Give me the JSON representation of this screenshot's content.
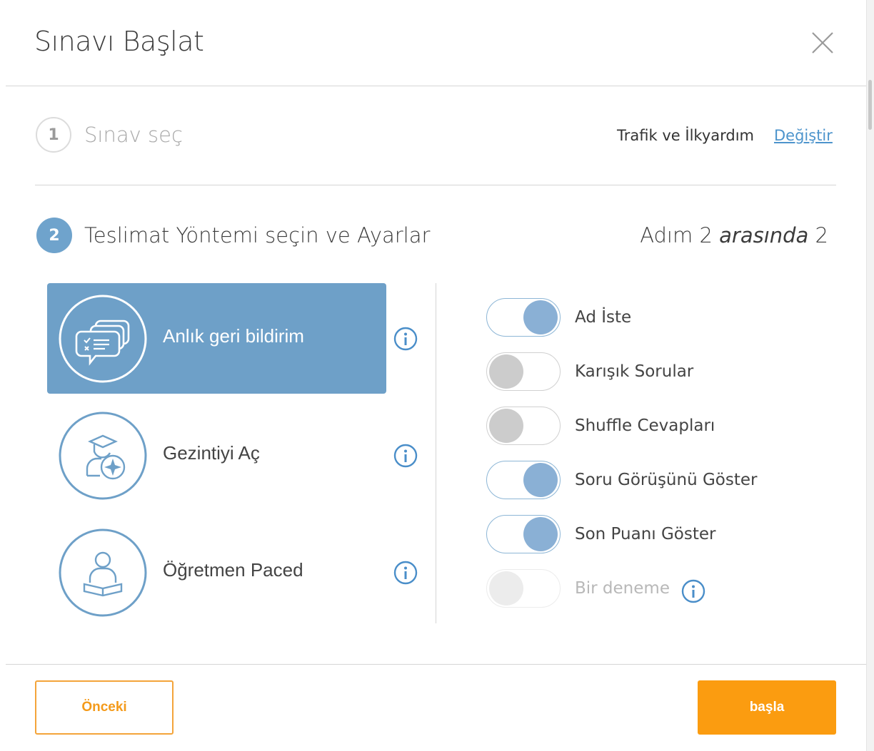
{
  "dialog": {
    "title": "Sınavı Başlat"
  },
  "step1": {
    "number": "1",
    "label": "Sınav seç",
    "exam_name": "Trafik ve İlkyardım",
    "change_link": "Değiştir"
  },
  "step2": {
    "number": "2",
    "label": "Teslimat Yöntemi seçin ve Ayarlar",
    "progress_prefix": "Adım 2",
    "progress_word": "arasında",
    "progress_suffix": "2"
  },
  "methods": [
    {
      "label": "Anlık geri bildirim",
      "icon": "feedback-chat-icon",
      "selected": true
    },
    {
      "label": "Gezintiyi Aç",
      "icon": "student-compass-icon",
      "selected": false
    },
    {
      "label": "Öğretmen Paced",
      "icon": "teacher-book-icon",
      "selected": false
    }
  ],
  "settings": [
    {
      "label": "Ad İste",
      "state": "on"
    },
    {
      "label": "Karışık Sorular",
      "state": "off"
    },
    {
      "label": "Shuffle Cevapları",
      "state": "off"
    },
    {
      "label": "Soru Görüşünü Göster",
      "state": "on"
    },
    {
      "label": "Son Puanı Göster",
      "state": "on"
    },
    {
      "label": "Bir deneme",
      "state": "disabled"
    }
  ],
  "footer": {
    "prev_label": "Önceki",
    "start_label": "başla"
  },
  "colors": {
    "accent_blue": "#6ea0c8",
    "toggle_on": "#8ab0d5",
    "orange": "#fb9c10",
    "link": "#4d94cc"
  }
}
